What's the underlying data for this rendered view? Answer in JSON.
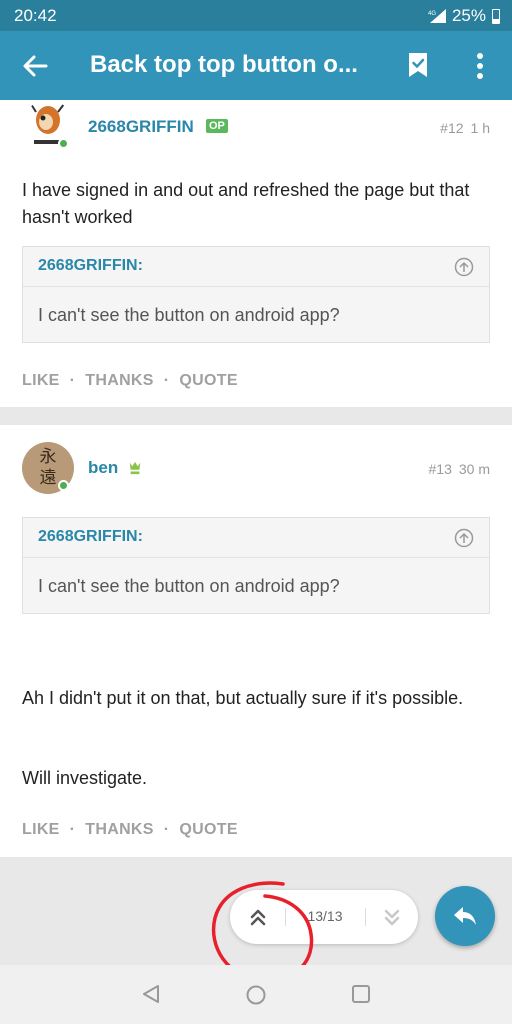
{
  "status_bar": {
    "time": "20:42",
    "network": "4G",
    "battery": "25%"
  },
  "app_bar": {
    "title": "Back top top button o..."
  },
  "posts": [
    {
      "username": "2668GRIFFIN",
      "badge": "OP",
      "post_number": "#12",
      "time_ago": "1 h",
      "body": "I have signed in and out and refreshed the page but that hasn't worked",
      "quote": {
        "author": "2668GRIFFIN:",
        "text": "I can't see the button on android app?"
      },
      "actions": [
        "LIKE",
        "THANKS",
        "QUOTE"
      ]
    },
    {
      "username": "ben",
      "avatar_text": "永遠",
      "post_number": "#13",
      "time_ago": "30 m",
      "quote": {
        "author": "2668GRIFFIN:",
        "text": "I can't see the button on android app?"
      },
      "body_paragraph_1": "Ah I didn't put it on that, but actually sure if it's possible.",
      "body_paragraph_2": "Will investigate.",
      "actions": [
        "LIKE",
        "THANKS",
        "QUOTE"
      ]
    }
  ],
  "pagination": {
    "position": "13/13"
  },
  "colors": {
    "primary": "#3194b8",
    "status_bar": "#2a7f9c",
    "link": "#2a87a9",
    "op_badge": "#5cb85c",
    "annotation": "#e8202c"
  }
}
